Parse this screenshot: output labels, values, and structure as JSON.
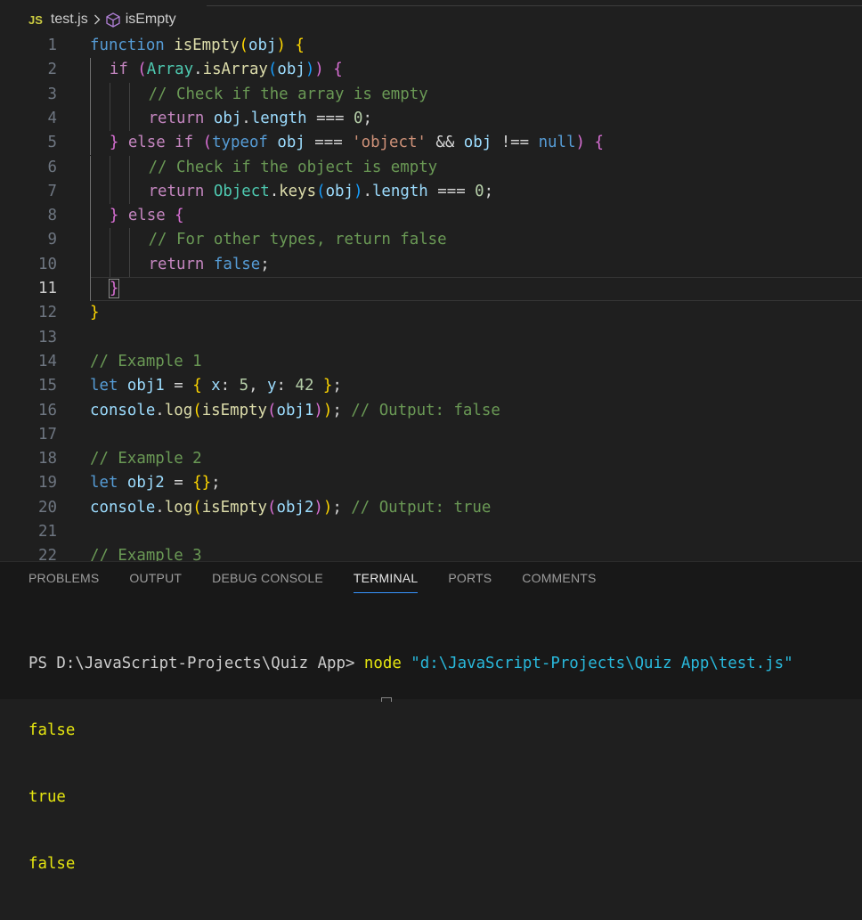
{
  "breadcrumb": {
    "js_badge": "JS",
    "file": "test.js",
    "symbol": "isEmpty"
  },
  "editor": {
    "current_line": 11,
    "lines": [
      {
        "n": "1",
        "tokens": [
          [
            "kw-bl",
            "function "
          ],
          [
            "fn",
            "isEmpty"
          ],
          [
            "b1",
            "("
          ],
          [
            "vr",
            "obj"
          ],
          [
            "b1",
            ")"
          ],
          [
            "pl",
            " "
          ],
          [
            "b1",
            "{"
          ]
        ]
      },
      {
        "n": "2",
        "tokens": [
          [
            "kw",
            "if "
          ],
          [
            "b2",
            "("
          ],
          [
            "cls",
            "Array"
          ],
          [
            "pl",
            "."
          ],
          [
            "fn",
            "isArray"
          ],
          [
            "b3",
            "("
          ],
          [
            "vr",
            "obj"
          ],
          [
            "b3",
            ")"
          ],
          [
            "b2",
            ")"
          ],
          [
            "pl",
            " "
          ],
          [
            "b2",
            "{"
          ]
        ]
      },
      {
        "n": "3",
        "tokens": [
          [
            "cm",
            "// Check if the array is empty"
          ]
        ]
      },
      {
        "n": "4",
        "tokens": [
          [
            "kw",
            "return "
          ],
          [
            "vr",
            "obj"
          ],
          [
            "pl",
            "."
          ],
          [
            "vr",
            "length"
          ],
          [
            "pl",
            " === "
          ],
          [
            "nm",
            "0"
          ],
          [
            "pl",
            ";"
          ]
        ]
      },
      {
        "n": "5",
        "tokens": [
          [
            "b2",
            "}"
          ],
          [
            "kw",
            " else if "
          ],
          [
            "b2",
            "("
          ],
          [
            "bl",
            "typeof"
          ],
          [
            "vr",
            " obj"
          ],
          [
            "pl",
            " === "
          ],
          [
            "st",
            "'object'"
          ],
          [
            "pl",
            " && "
          ],
          [
            "vr",
            "obj"
          ],
          [
            "pl",
            " !== "
          ],
          [
            "bl",
            "null"
          ],
          [
            "b2",
            ")"
          ],
          [
            "pl",
            " "
          ],
          [
            "b2",
            "{"
          ]
        ]
      },
      {
        "n": "6",
        "tokens": [
          [
            "cm",
            "// Check if the object is empty"
          ]
        ]
      },
      {
        "n": "7",
        "tokens": [
          [
            "kw",
            "return "
          ],
          [
            "cls",
            "Object"
          ],
          [
            "pl",
            "."
          ],
          [
            "fn",
            "keys"
          ],
          [
            "b3",
            "("
          ],
          [
            "vr",
            "obj"
          ],
          [
            "b3",
            ")"
          ],
          [
            "pl",
            "."
          ],
          [
            "vr",
            "length"
          ],
          [
            "pl",
            " === "
          ],
          [
            "nm",
            "0"
          ],
          [
            "pl",
            ";"
          ]
        ]
      },
      {
        "n": "8",
        "tokens": [
          [
            "b2",
            "}"
          ],
          [
            "kw",
            " else "
          ],
          [
            "b2",
            "{"
          ]
        ]
      },
      {
        "n": "9",
        "tokens": [
          [
            "cm",
            "// For other types, return false"
          ]
        ]
      },
      {
        "n": "10",
        "tokens": [
          [
            "kw",
            "return "
          ],
          [
            "bl",
            "false"
          ],
          [
            "pl",
            ";"
          ]
        ]
      },
      {
        "n": "11",
        "tokens": [
          [
            "b2",
            "}"
          ]
        ]
      },
      {
        "n": "12",
        "tokens": [
          [
            "b1",
            "}"
          ]
        ]
      },
      {
        "n": "13",
        "tokens": []
      },
      {
        "n": "14",
        "tokens": [
          [
            "cm",
            "// Example 1"
          ]
        ]
      },
      {
        "n": "15",
        "tokens": [
          [
            "bl",
            "let "
          ],
          [
            "vr",
            "obj1"
          ],
          [
            "pl",
            " = "
          ],
          [
            "b1",
            "{"
          ],
          [
            "pl",
            " "
          ],
          [
            "vr",
            "x"
          ],
          [
            "pl",
            ": "
          ],
          [
            "nm",
            "5"
          ],
          [
            "pl",
            ", "
          ],
          [
            "vr",
            "y"
          ],
          [
            "pl",
            ": "
          ],
          [
            "nm",
            "42"
          ],
          [
            "pl",
            " "
          ],
          [
            "b1",
            "}"
          ],
          [
            "pl",
            ";"
          ]
        ]
      },
      {
        "n": "16",
        "tokens": [
          [
            "vr",
            "console"
          ],
          [
            "pl",
            "."
          ],
          [
            "fn",
            "log"
          ],
          [
            "b1",
            "("
          ],
          [
            "fn",
            "isEmpty"
          ],
          [
            "b2",
            "("
          ],
          [
            "vr",
            "obj1"
          ],
          [
            "b2",
            ")"
          ],
          [
            "b1",
            ")"
          ],
          [
            "pl",
            "; "
          ],
          [
            "cm",
            "// Output: false"
          ]
        ]
      },
      {
        "n": "17",
        "tokens": []
      },
      {
        "n": "18",
        "tokens": [
          [
            "cm",
            "// Example 2"
          ]
        ]
      },
      {
        "n": "19",
        "tokens": [
          [
            "bl",
            "let "
          ],
          [
            "vr",
            "obj2"
          ],
          [
            "pl",
            " = "
          ],
          [
            "b1",
            "{}"
          ],
          [
            "pl",
            ";"
          ]
        ]
      },
      {
        "n": "20",
        "tokens": [
          [
            "vr",
            "console"
          ],
          [
            "pl",
            "."
          ],
          [
            "fn",
            "log"
          ],
          [
            "b1",
            "("
          ],
          [
            "fn",
            "isEmpty"
          ],
          [
            "b2",
            "("
          ],
          [
            "vr",
            "obj2"
          ],
          [
            "b2",
            ")"
          ],
          [
            "b1",
            ")"
          ],
          [
            "pl",
            "; "
          ],
          [
            "cm",
            "// Output: true"
          ]
        ]
      },
      {
        "n": "21",
        "tokens": []
      },
      {
        "n": "22",
        "tokens": [
          [
            "cm",
            "// Example 3"
          ]
        ]
      }
    ]
  },
  "panel": {
    "tabs": [
      {
        "label": "PROBLEMS",
        "active": false
      },
      {
        "label": "OUTPUT",
        "active": false
      },
      {
        "label": "DEBUG CONSOLE",
        "active": false
      },
      {
        "label": "TERMINAL",
        "active": true
      },
      {
        "label": "PORTS",
        "active": false
      },
      {
        "label": "COMMENTS",
        "active": false
      }
    ],
    "terminal": {
      "prompt": "PS D:\\JavaScript-Projects\\Quiz App> ",
      "command": "node",
      "argument": "\"d:\\JavaScript-Projects\\Quiz App\\test.js\"",
      "output": [
        "false",
        "true",
        "false"
      ]
    }
  }
}
